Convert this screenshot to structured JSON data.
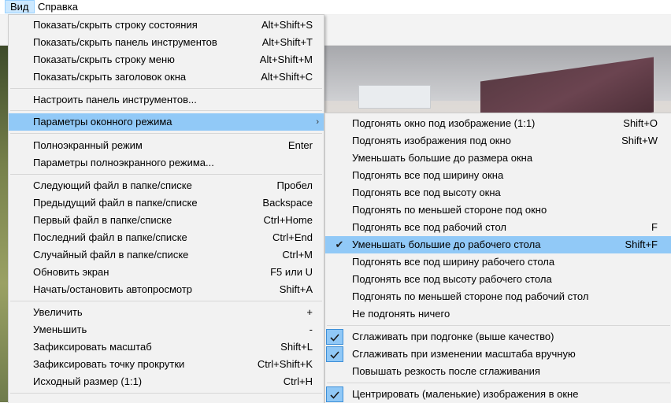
{
  "menubar": {
    "items": [
      "Вид",
      "Справка"
    ]
  },
  "main_menu": [
    {
      "label": "Показать/скрыть строку состояния",
      "shortcut": "Alt+Shift+S"
    },
    {
      "label": "Показать/скрыть панель инструментов",
      "shortcut": "Alt+Shift+T"
    },
    {
      "label": "Показать/скрыть строку меню",
      "shortcut": "Alt+Shift+M"
    },
    {
      "label": "Показать/скрыть заголовок окна",
      "shortcut": "Alt+Shift+C"
    },
    {
      "label": "Настроить панель инструментов...",
      "shortcut": ""
    },
    {
      "label": "Параметры оконного режима",
      "shortcut": "",
      "submenu": true
    },
    {
      "label": "Полноэкранный режим",
      "shortcut": "Enter"
    },
    {
      "label": "Параметры полноэкранного режима...",
      "shortcut": ""
    },
    {
      "label": "Следующий файл в папке/списке",
      "shortcut": "Пробел"
    },
    {
      "label": "Предыдущий файл в папке/списке",
      "shortcut": "Backspace"
    },
    {
      "label": "Первый файл в папке/списке",
      "shortcut": "Ctrl+Home"
    },
    {
      "label": "Последний файл в папке/списке",
      "shortcut": "Ctrl+End"
    },
    {
      "label": "Случайный файл в папке/списке",
      "shortcut": "Ctrl+M"
    },
    {
      "label": "Обновить экран",
      "shortcut": "F5 или U"
    },
    {
      "label": "Начать/остановить автопросмотр",
      "shortcut": "Shift+A"
    },
    {
      "label": "Увеличить",
      "shortcut": "+"
    },
    {
      "label": "Уменьшить",
      "shortcut": "-"
    },
    {
      "label": "Зафиксировать масштаб",
      "shortcut": "Shift+L"
    },
    {
      "label": "Зафиксировать точку прокрутки",
      "shortcut": "Ctrl+Shift+K"
    },
    {
      "label": "Исходный размер (1:1)",
      "shortcut": "Ctrl+H"
    }
  ],
  "sub_menu": [
    {
      "label": "Подгонять окно под изображение (1:1)",
      "shortcut": "Shift+O",
      "checked": false
    },
    {
      "label": "Подгонять изображения под окно",
      "shortcut": "Shift+W",
      "checked": false
    },
    {
      "label": "Уменьшать большие до размера окна",
      "shortcut": "",
      "checked": false
    },
    {
      "label": "Подгонять все под ширину окна",
      "shortcut": "",
      "checked": false
    },
    {
      "label": "Подгонять все под высоту окна",
      "shortcut": "",
      "checked": false
    },
    {
      "label": "Подгонять по меньшей стороне под окно",
      "shortcut": "",
      "checked": false
    },
    {
      "label": "Подгонять все под рабочий стол",
      "shortcut": "F",
      "checked": false
    },
    {
      "label": "Уменьшать большие до рабочего стола",
      "shortcut": "Shift+F",
      "checked": true
    },
    {
      "label": "Подгонять все под ширину рабочего стола",
      "shortcut": "",
      "checked": false
    },
    {
      "label": "Подгонять все под высоту рабочего стола",
      "shortcut": "",
      "checked": false
    },
    {
      "label": "Подгонять по меньшей стороне под рабочий стол",
      "shortcut": "",
      "checked": false
    },
    {
      "label": "Не подгонять ничего",
      "shortcut": "",
      "checked": false
    },
    {
      "label": "Сглаживать при подгонке (выше качество)",
      "shortcut": "",
      "checked": true
    },
    {
      "label": "Сглаживать при изменении масштаба вручную",
      "shortcut": "",
      "checked": true
    },
    {
      "label": "Повышать резкость после сглаживания",
      "shortcut": "",
      "checked": false
    },
    {
      "label": "Центрировать (маленькие) изображения в окне",
      "shortcut": "",
      "checked": true
    }
  ],
  "colors": {
    "highlight": "#91c9f7",
    "menu_bg": "#f2f2f2",
    "separator": "#d7d7d7"
  },
  "icons": {
    "submenu_arrow": "chevron-right-icon",
    "check": "check-icon"
  }
}
